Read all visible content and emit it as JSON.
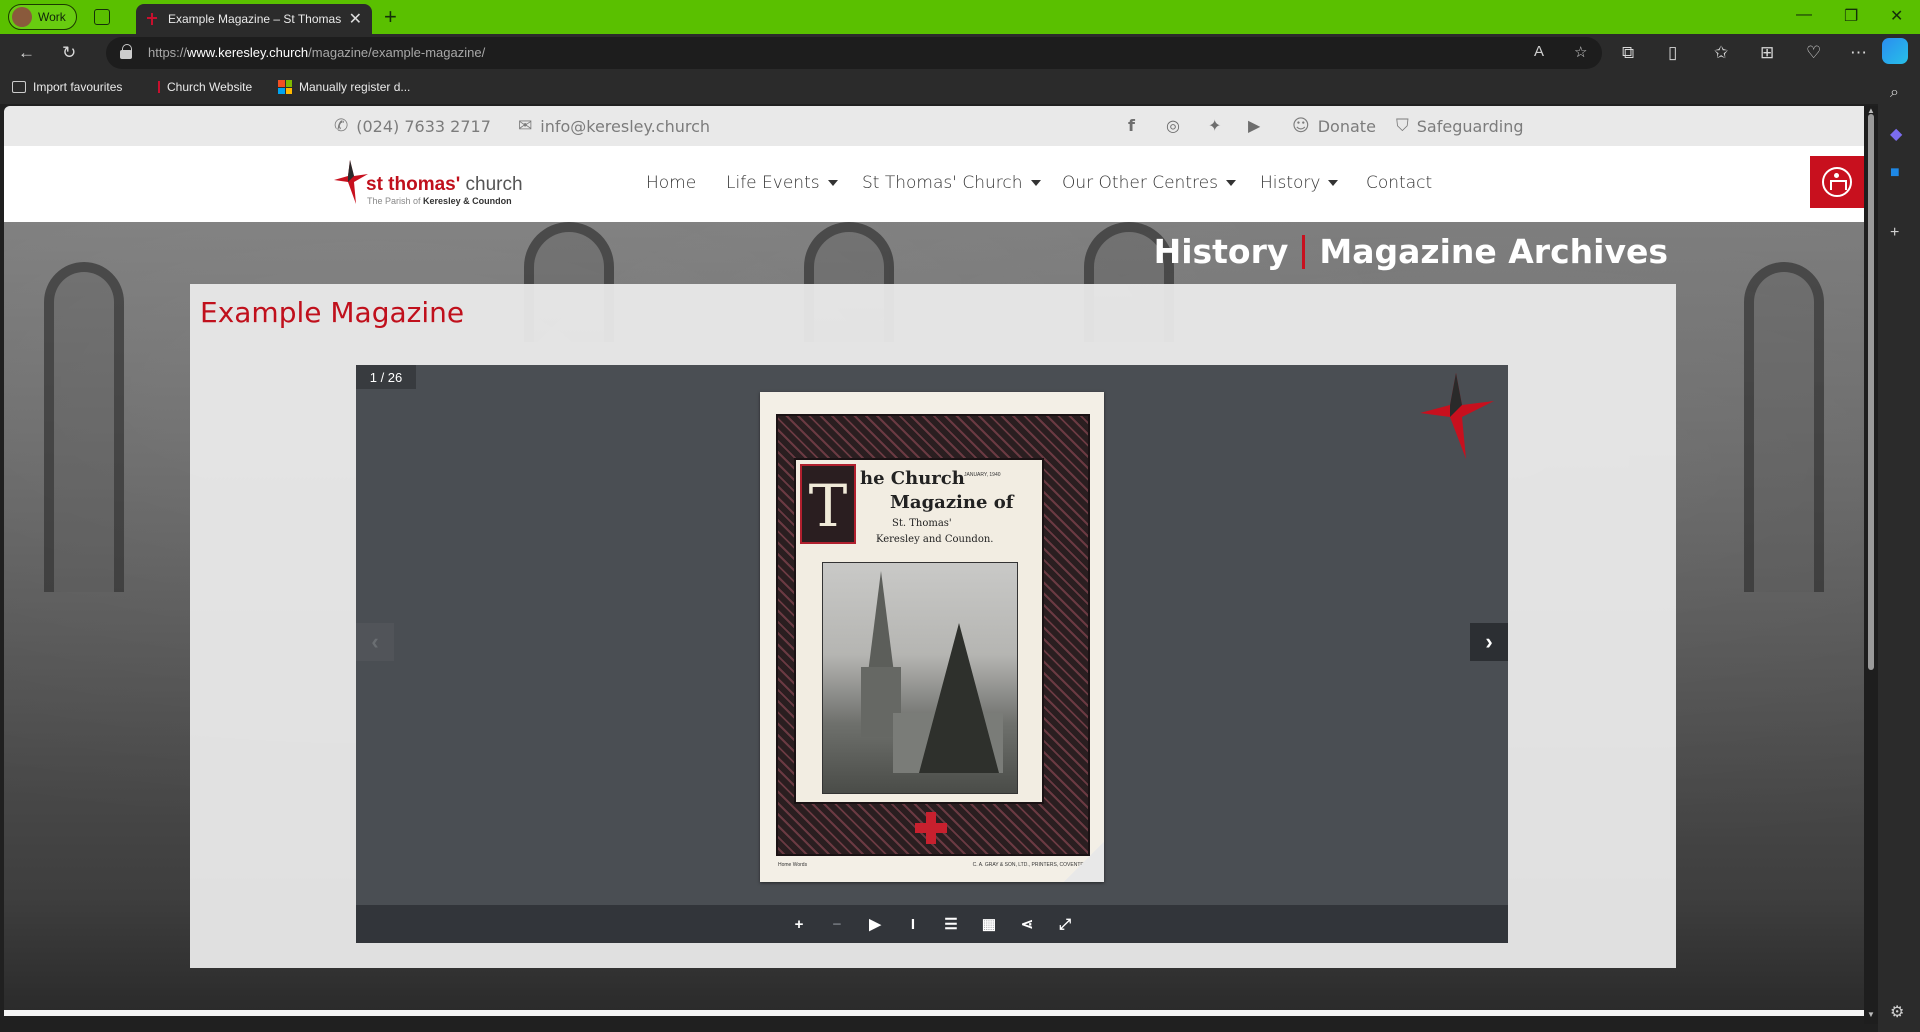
{
  "browser": {
    "profile_label": "Work",
    "tab_title": "Example Magazine – St Thomas'",
    "url_prefix": "https://",
    "url_host": "www.keresley.church",
    "url_path": "/magazine/example-magazine/",
    "favourites": [
      {
        "label": "Import favourites",
        "icon": "import-icon"
      },
      {
        "label": "Church Website",
        "icon": "church-cross-icon"
      },
      {
        "label": "Manually register d...",
        "icon": "microsoft-icon"
      }
    ],
    "theme_color": "#5ac000"
  },
  "site": {
    "phone": "(024) 7633 2717",
    "email": "info@keresley.church",
    "social": [
      "facebook",
      "instagram",
      "twitter",
      "youtube"
    ],
    "donate_label": "Donate",
    "safeguarding_label": "Safeguarding",
    "logo": {
      "name_bold": "st thomas'",
      "name_light": "church",
      "sub_prefix": "The Parish of",
      "sub_bold": "Keresley & Coundon"
    },
    "nav": [
      {
        "label": "Home",
        "dropdown": false
      },
      {
        "label": "Life Events",
        "dropdown": true
      },
      {
        "label": "St Thomas' Church",
        "dropdown": true
      },
      {
        "label": "Our Other Centres",
        "dropdown": true
      },
      {
        "label": "History",
        "dropdown": true
      },
      {
        "label": "Contact",
        "dropdown": false
      }
    ],
    "accent_color": "#c8101e"
  },
  "page": {
    "breadcrumb_1": "History",
    "breadcrumb_2": "Magazine Archives",
    "title": "Example Magazine"
  },
  "viewer": {
    "page_indicator": "1 / 26",
    "current_page": 1,
    "total_pages": 26,
    "controls": [
      "zoom-in",
      "zoom-out",
      "play",
      "text-select",
      "table-of-contents",
      "thumbnails",
      "share",
      "fullscreen"
    ],
    "cover": {
      "drop_cap": "T",
      "line1": "he Church",
      "line2": "Magazine of",
      "line3": "St. Thomas'",
      "line4": "Keresley and Coundon.",
      "date": "JANUARY, 1940",
      "footer_left": "Home Words",
      "footer_center": "C. A. GRAY & SON, LTD., PRINTERS, COVENTRY."
    }
  }
}
